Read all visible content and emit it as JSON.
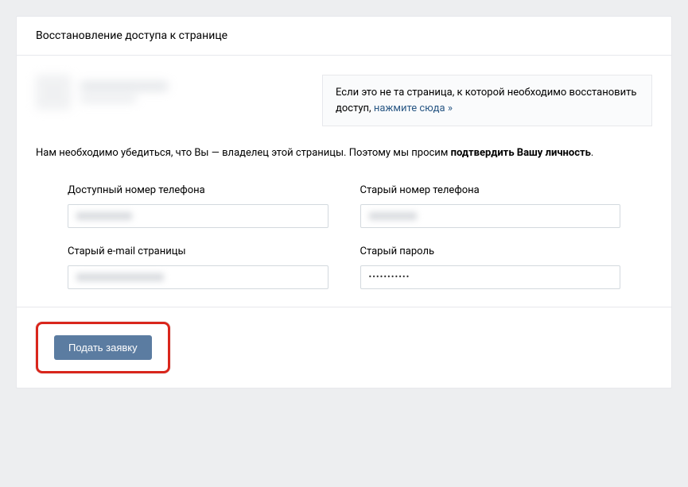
{
  "header": {
    "title": "Восстановление доступа к странице"
  },
  "notice": {
    "text_before": "Если это не та страница, к которой необходимо восстановить доступ, ",
    "link_text": "нажмите сюда »"
  },
  "description": {
    "text_before": "Нам необходимо убедиться, что Вы — владелец этой страницы. Поэтому мы просим ",
    "bold_text": "подтвердить Вашу личность",
    "text_after": "."
  },
  "form": {
    "available_phone": {
      "label": "Доступный номер телефона",
      "value": ""
    },
    "old_phone": {
      "label": "Старый номер телефона",
      "value": ""
    },
    "old_email": {
      "label": "Старый e-mail страницы",
      "value": ""
    },
    "old_password": {
      "label": "Старый пароль",
      "value": "•••••••••••"
    }
  },
  "footer": {
    "submit_label": "Подать заявку"
  }
}
